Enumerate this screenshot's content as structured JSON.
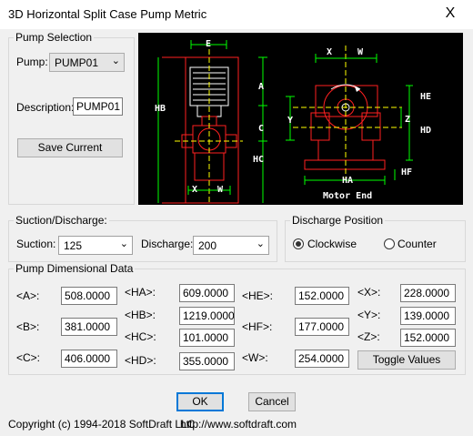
{
  "window": {
    "title": "3D Horizontal Split Case Pump Metric",
    "close_glyph": "X"
  },
  "pump_selection": {
    "group_label": "Pump Selection",
    "pump_label": "Pump:",
    "pump_value": "PUMP01",
    "description_label": "Description:",
    "description_value": "PUMP01",
    "save_button": "Save Current"
  },
  "drawing": {
    "labels_left": {
      "E": "E",
      "A": "A",
      "HB": "HB",
      "C": "C",
      "HC": "HC",
      "X": "X",
      "W": "W"
    },
    "labels_right": {
      "X": "X",
      "W": "W",
      "HE": "HE",
      "Y": "Y",
      "Z": "Z",
      "HD": "HD",
      "HA": "HA",
      "HF": "HF"
    },
    "caption": "Motor End"
  },
  "suction_discharge": {
    "group_label": "Suction/Discharge:",
    "suction_label": "Suction:",
    "suction_value": "125",
    "discharge_label": "Discharge:",
    "discharge_value": "200"
  },
  "discharge_position": {
    "group_label": "Discharge Position",
    "clockwise_label": "Clockwise",
    "counter_label": "Counter",
    "selected": "Clockwise"
  },
  "dimensions": {
    "group_label": "Pump Dimensional Data",
    "A_label": "<A>:",
    "A_value": "508.0000",
    "B_label": "<B>:",
    "B_value": "381.0000",
    "C_label": "<C>:",
    "C_value": "406.0000",
    "HA_label": "<HA>:",
    "HA_value": "609.0000",
    "HB_label": "<HB>:",
    "HB_value": "1219.0000",
    "HC_label": "<HC>:",
    "HC_value": "101.0000",
    "HD_label": "<HD>:",
    "HD_value": "355.0000",
    "HE_label": "<HE>:",
    "HE_value": "152.0000",
    "HF_label": "<HF>:",
    "HF_value": "177.0000",
    "W_label": "<W>:",
    "W_value": "254.0000",
    "X_label": "<X>:",
    "X_value": "228.0000",
    "Y_label": "<Y>:",
    "Y_value": "139.0000",
    "Z_label": "<Z>:",
    "Z_value": "152.0000",
    "toggle_button": "Toggle Values"
  },
  "footer": {
    "ok_button": "OK",
    "cancel_button": "Cancel",
    "copyright": "Copyright (c) 1994-2018 SoftDraft LLC",
    "website": "http://www.softdraft.com"
  },
  "colors": {
    "accent": "#0078d7",
    "drawing_bg": "#000000",
    "dim_green": "#00ff00",
    "outline_red": "#ff2020",
    "label_yellow": "#ffff00"
  }
}
